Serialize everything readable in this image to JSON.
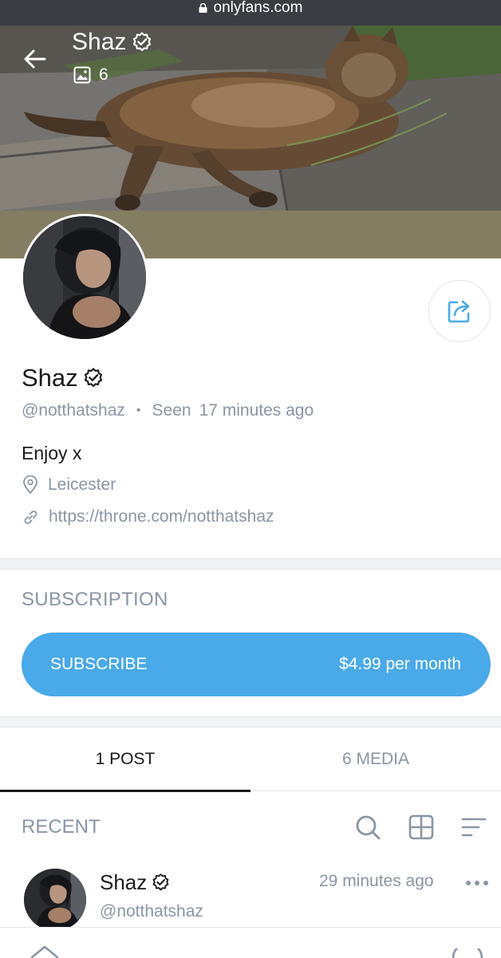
{
  "browser": {
    "url": "onlyfans.com"
  },
  "header": {
    "name": "Shaz",
    "media_count": "6"
  },
  "profile": {
    "name": "Shaz",
    "handle": "@notthatshaz",
    "separator": "•",
    "seen_label": "Seen",
    "seen_time": "17 minutes ago",
    "bio": "Enjoy x",
    "location": "Leicester",
    "link": "https://throne.com/notthatshaz"
  },
  "subscription": {
    "heading": "SUBSCRIPTION",
    "button_label": "SUBSCRIBE",
    "price": "$4.99 per month"
  },
  "tabs": [
    {
      "label": "1 POST",
      "active": true
    },
    {
      "label": "6 MEDIA",
      "active": false
    }
  ],
  "recent": {
    "label": "RECENT",
    "icons": [
      "search-icon",
      "grid-icon",
      "sort-icon"
    ]
  },
  "post": {
    "name": "Shaz",
    "handle": "@notthatshaz",
    "time": "29 minutes ago"
  },
  "colors": {
    "accent": "#4aa9e8",
    "muted_text": "#8a96a3",
    "url_bar": "#3a3d42"
  }
}
